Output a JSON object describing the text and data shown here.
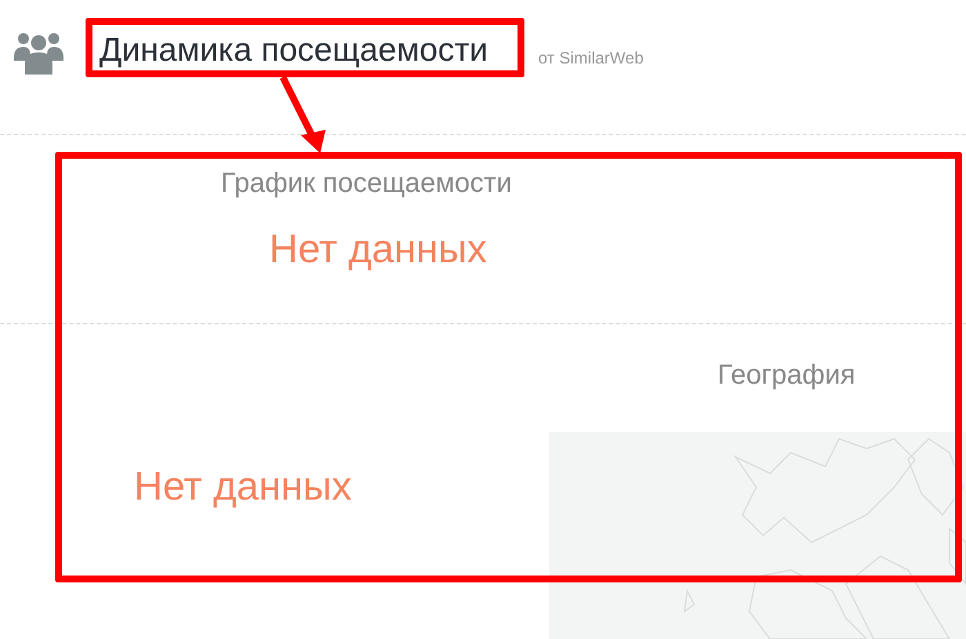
{
  "header": {
    "title": "Динамика посещаемости",
    "source": "от SimilarWeb"
  },
  "sections": [
    {
      "kind": "chart",
      "title": "График посещаемости",
      "empty_text": "Нет данных"
    },
    {
      "kind": "geo",
      "title": "География",
      "empty_text": "Нет данных"
    }
  ]
}
